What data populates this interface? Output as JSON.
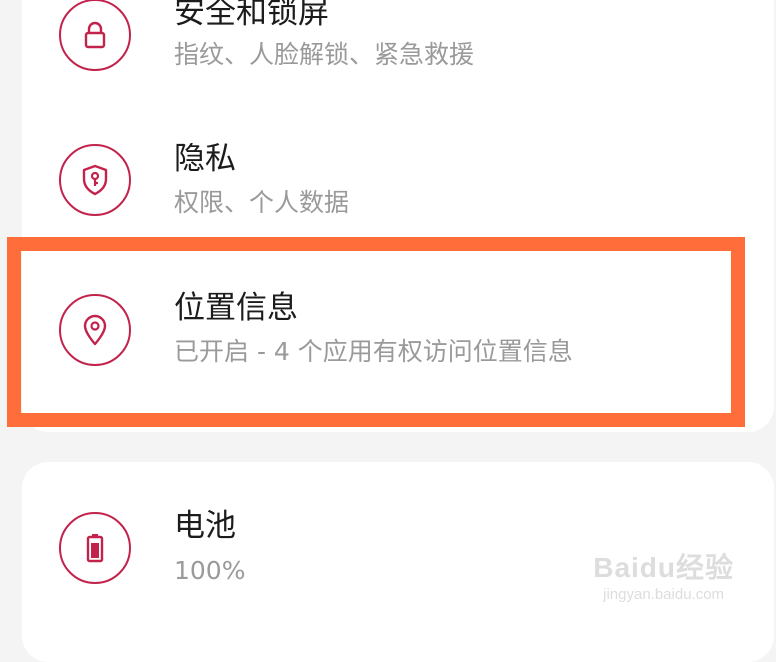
{
  "settings": {
    "items": [
      {
        "title": "安全和锁屏",
        "subtitle": "指纹、人脸解锁、紧急救援",
        "icon": "lock-icon"
      },
      {
        "title": "隐私",
        "subtitle": "权限、个人数据",
        "icon": "privacy-shield-icon"
      },
      {
        "title": "位置信息",
        "subtitle": "已开启 - 4 个应用有权访问位置信息",
        "icon": "location-pin-icon"
      },
      {
        "title": "电池",
        "subtitle": "100%",
        "icon": "battery-icon"
      }
    ]
  },
  "watermark": {
    "brand": "Baidu经验",
    "url": "jingyan.baidu.com"
  },
  "colors": {
    "accent": "#c2234c",
    "highlight": "#ff6e3a",
    "background": "#f4f4f4",
    "card": "#ffffff"
  }
}
